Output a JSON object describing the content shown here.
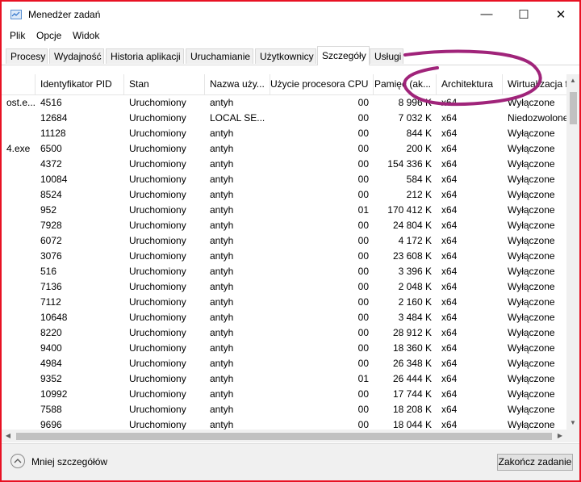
{
  "window": {
    "title": "Menedżer zadań",
    "minimize_glyph": "—",
    "maximize_glyph": "☐",
    "close_glyph": "✕"
  },
  "menu": [
    "Plik",
    "Opcje",
    "Widok"
  ],
  "tabs": [
    "Procesy",
    "Wydajność",
    "Historia aplikacji",
    "Uruchamianie",
    "Użytkownicy",
    "Szczegóły",
    "Usługi"
  ],
  "active_tab": "Szczegóły",
  "columns": [
    "",
    "Identyfikator PID",
    "Stan",
    "Nazwa uży...",
    "Użycie procesora CPU",
    "Pamięć (ak...",
    "Architektura",
    "Wirtualizacja f"
  ],
  "rows": [
    [
      "ost.e...",
      "4516",
      "Uruchomiony",
      "antyh",
      "00",
      "8 996 K",
      "x64",
      "Wyłączone"
    ],
    [
      "",
      "12684",
      "Uruchomiony",
      "LOCAL SE...",
      "00",
      "7 032 K",
      "x64",
      "Niedozwolone"
    ],
    [
      "",
      "11128",
      "Uruchomiony",
      "antyh",
      "00",
      "844 K",
      "x64",
      "Wyłączone"
    ],
    [
      "4.exe",
      "6500",
      "Uruchomiony",
      "antyh",
      "00",
      "200 K",
      "x64",
      "Wyłączone"
    ],
    [
      "",
      "4372",
      "Uruchomiony",
      "antyh",
      "00",
      "154 336 K",
      "x64",
      "Wyłączone"
    ],
    [
      "",
      "10084",
      "Uruchomiony",
      "antyh",
      "00",
      "584 K",
      "x64",
      "Wyłączone"
    ],
    [
      "",
      "8524",
      "Uruchomiony",
      "antyh",
      "00",
      "212 K",
      "x64",
      "Wyłączone"
    ],
    [
      "",
      "952",
      "Uruchomiony",
      "antyh",
      "01",
      "170 412 K",
      "x64",
      "Wyłączone"
    ],
    [
      "",
      "7928",
      "Uruchomiony",
      "antyh",
      "00",
      "24 804 K",
      "x64",
      "Wyłączone"
    ],
    [
      "",
      "6072",
      "Uruchomiony",
      "antyh",
      "00",
      "4 172 K",
      "x64",
      "Wyłączone"
    ],
    [
      "",
      "3076",
      "Uruchomiony",
      "antyh",
      "00",
      "23 608 K",
      "x64",
      "Wyłączone"
    ],
    [
      "",
      "516",
      "Uruchomiony",
      "antyh",
      "00",
      "3 396 K",
      "x64",
      "Wyłączone"
    ],
    [
      "",
      "7136",
      "Uruchomiony",
      "antyh",
      "00",
      "2 048 K",
      "x64",
      "Wyłączone"
    ],
    [
      "",
      "7112",
      "Uruchomiony",
      "antyh",
      "00",
      "2 160 K",
      "x64",
      "Wyłączone"
    ],
    [
      "",
      "10648",
      "Uruchomiony",
      "antyh",
      "00",
      "3 484 K",
      "x64",
      "Wyłączone"
    ],
    [
      "",
      "8220",
      "Uruchomiony",
      "antyh",
      "00",
      "28 912 K",
      "x64",
      "Wyłączone"
    ],
    [
      "",
      "9400",
      "Uruchomiony",
      "antyh",
      "00",
      "18 360 K",
      "x64",
      "Wyłączone"
    ],
    [
      "",
      "4984",
      "Uruchomiony",
      "antyh",
      "00",
      "26 348 K",
      "x64",
      "Wyłączone"
    ],
    [
      "",
      "9352",
      "Uruchomiony",
      "antyh",
      "01",
      "26 444 K",
      "x64",
      "Wyłączone"
    ],
    [
      "",
      "10992",
      "Uruchomiony",
      "antyh",
      "00",
      "17 744 K",
      "x64",
      "Wyłączone"
    ],
    [
      "",
      "7588",
      "Uruchomiony",
      "antyh",
      "00",
      "18 208 K",
      "x64",
      "Wyłączone"
    ],
    [
      "",
      "9696",
      "Uruchomiony",
      "antyh",
      "00",
      "18 044 K",
      "x64",
      "Wyłączone"
    ]
  ],
  "footer": {
    "less_details": "Mniej szczegółów",
    "end_task": "Zakończ zadanie"
  },
  "colors": {
    "window_border": "#e81123",
    "annotation_stroke": "#a0247a"
  },
  "icons": {
    "app": "task-manager-icon",
    "less_details": "chevron-up-circle-icon"
  }
}
